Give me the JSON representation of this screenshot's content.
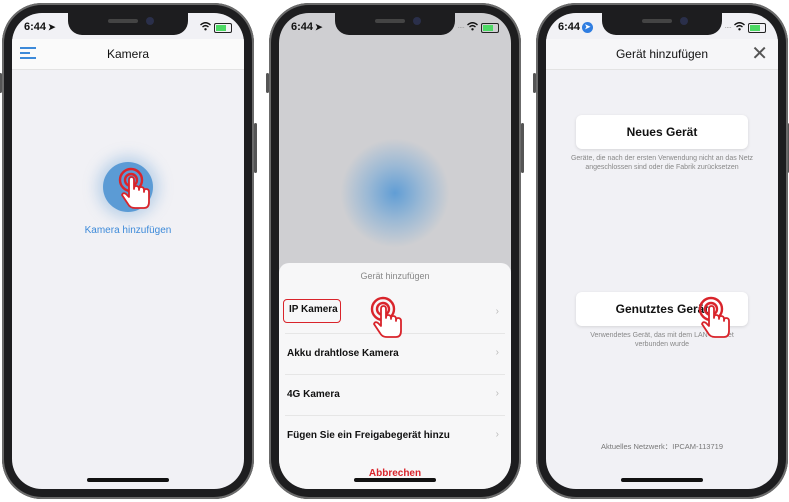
{
  "phones": [
    {
      "status": {
        "time": "6:44"
      },
      "nav": {
        "title": "Kamera"
      },
      "add_label": "Kamera hinzufügen"
    },
    {
      "status": {
        "time": "6:44"
      },
      "sheet": {
        "title": "Gerät hinzufügen",
        "items": [
          "IP Kamera",
          "Akku drahtlose Kamera",
          "4G Kamera",
          "Fügen Sie ein Freigabegerät hinzu"
        ],
        "cancel": "Abbrechen"
      }
    },
    {
      "status": {
        "time": "6:44"
      },
      "nav": {
        "title": "Gerät hinzufügen",
        "close": "✕"
      },
      "new_device": {
        "label": "Neues Gerät",
        "desc": "Geräte, die nach der ersten Verwendung nicht an das Netz angeschlossen sind oder die Fabrik zurücksetzen"
      },
      "used_device": {
        "label": "Genutztes Gerät",
        "desc": "Verwendetes Gerät, das mit dem LAN-Internet verbunden wurde"
      },
      "network": "Aktuelles Netzwerk：IPCAM-113719"
    }
  ],
  "colors": {
    "accent": "#3d8ad9",
    "circle": "#5b9bd5",
    "highlight": "#d9242b"
  }
}
